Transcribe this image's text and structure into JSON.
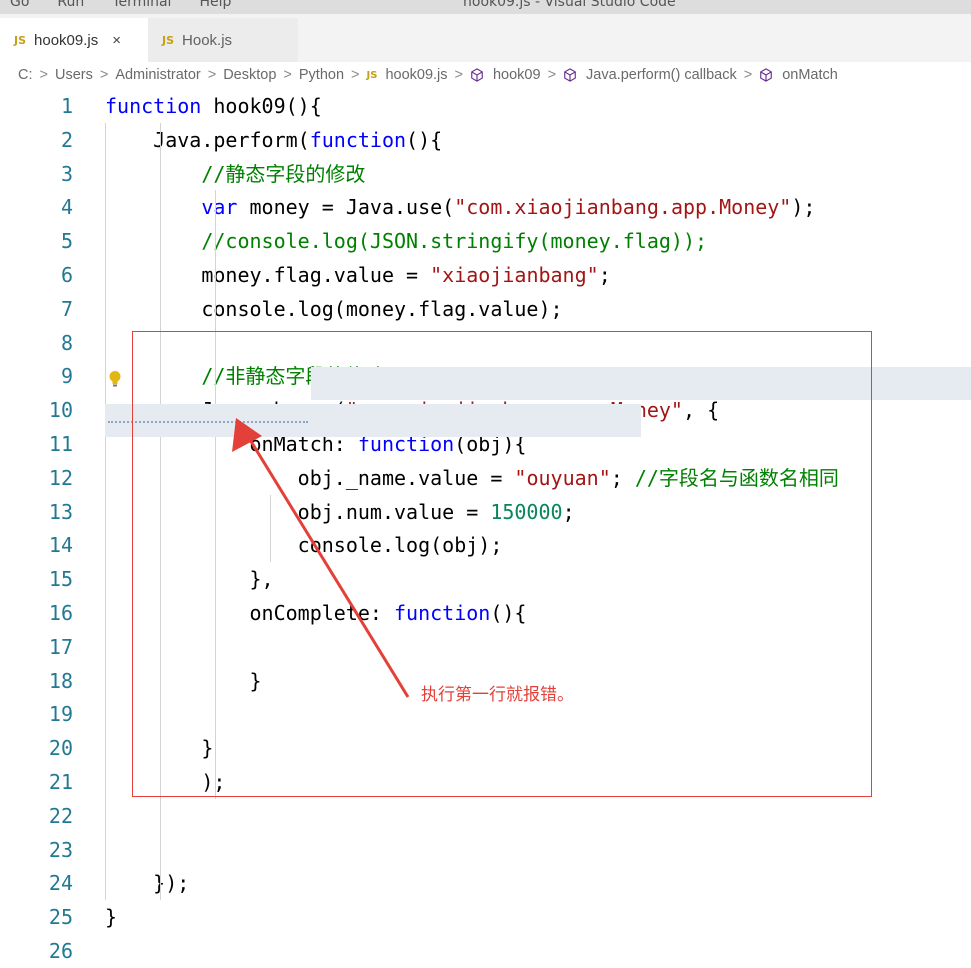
{
  "titlebar": {
    "menu": [
      "Go",
      "Run",
      "Terminal",
      "Help"
    ],
    "title": "hook09.js - Visual Studio Code"
  },
  "tabs": [
    {
      "icon": "JS",
      "label": "hook09.js",
      "active": true,
      "close": "×"
    },
    {
      "icon": "JS",
      "label": "Hook.js",
      "active": false
    }
  ],
  "breadcrumb": {
    "items": [
      "C:",
      "Users",
      "Administrator",
      "Desktop",
      "Python",
      "hook09.js",
      "hook09",
      "Java.perform() callback",
      "onMatch"
    ],
    "separator": ">"
  },
  "annotation": {
    "text": "执行第一行就报错。",
    "color": "#e4403a"
  },
  "colors": {
    "keyword": "#0000ff",
    "string": "#a31515",
    "comment": "#008000",
    "number": "#098658",
    "lineNumber": "#237893",
    "annotation": "#e4403a"
  },
  "code": {
    "lines": [
      {
        "n": "1",
        "tokens": [
          {
            "c": "kw",
            "t": "function"
          },
          {
            "c": "",
            "t": " hook09(){"
          }
        ]
      },
      {
        "n": "2",
        "tokens": [
          {
            "c": "",
            "t": "    Java.perform("
          },
          {
            "c": "kw",
            "t": "function"
          },
          {
            "c": "",
            "t": "(){"
          }
        ]
      },
      {
        "n": "3",
        "tokens": [
          {
            "c": "cm",
            "t": "        //静态字段的修改"
          }
        ]
      },
      {
        "n": "4",
        "tokens": [
          {
            "c": "",
            "t": "        "
          },
          {
            "c": "kw",
            "t": "var"
          },
          {
            "c": "",
            "t": " money = Java.use("
          },
          {
            "c": "str",
            "t": "\"com.xiaojianbang.app.Money\""
          },
          {
            "c": "",
            "t": ");"
          }
        ]
      },
      {
        "n": "5",
        "tokens": [
          {
            "c": "cm",
            "t": "        //console.log(JSON.stringify(money.flag));"
          }
        ]
      },
      {
        "n": "6",
        "tokens": [
          {
            "c": "",
            "t": "        money.flag.value = "
          },
          {
            "c": "str",
            "t": "\"xiaojianbang\""
          },
          {
            "c": "",
            "t": ";"
          }
        ]
      },
      {
        "n": "7",
        "tokens": [
          {
            "c": "",
            "t": "        console.log(money.flag.value);"
          }
        ]
      },
      {
        "n": "8",
        "tokens": []
      },
      {
        "n": "9",
        "tokens": [
          {
            "c": "cm",
            "t": "        //非静态字段的修改"
          }
        ]
      },
      {
        "n": "10",
        "tokens": [
          {
            "c": "",
            "t": "        Java.choose("
          },
          {
            "c": "str",
            "t": "\"com.xiaojianbang.app.Money\""
          },
          {
            "c": "",
            "t": ", {"
          }
        ]
      },
      {
        "n": "11",
        "tokens": [
          {
            "c": "",
            "t": "            onMatch: "
          },
          {
            "c": "kw",
            "t": "function"
          },
          {
            "c": "",
            "t": "(obj){"
          }
        ]
      },
      {
        "n": "12",
        "tokens": [
          {
            "c": "",
            "t": "                obj._name.value = "
          },
          {
            "c": "str",
            "t": "\"ouyuan\""
          },
          {
            "c": "",
            "t": "; "
          },
          {
            "c": "cm",
            "t": "//字段名与函数名相同"
          }
        ]
      },
      {
        "n": "13",
        "tokens": [
          {
            "c": "",
            "t": "                obj.num.value = "
          },
          {
            "c": "num",
            "t": "150000"
          },
          {
            "c": "",
            "t": ";"
          }
        ]
      },
      {
        "n": "14",
        "tokens": [
          {
            "c": "",
            "t": "                console.log(obj);"
          }
        ]
      },
      {
        "n": "15",
        "tokens": [
          {
            "c": "",
            "t": "            },"
          }
        ]
      },
      {
        "n": "16",
        "tokens": [
          {
            "c": "",
            "t": "            onComplete: "
          },
          {
            "c": "kw",
            "t": "function"
          },
          {
            "c": "",
            "t": "(){"
          }
        ]
      },
      {
        "n": "17",
        "tokens": []
      },
      {
        "n": "18",
        "tokens": [
          {
            "c": "",
            "t": "            }"
          }
        ]
      },
      {
        "n": "19",
        "tokens": []
      },
      {
        "n": "20",
        "tokens": [
          {
            "c": "",
            "t": "        }"
          }
        ]
      },
      {
        "n": "21",
        "tokens": [
          {
            "c": "",
            "t": "        );"
          }
        ]
      },
      {
        "n": "22",
        "tokens": []
      },
      {
        "n": "23",
        "tokens": []
      },
      {
        "n": "24",
        "tokens": [
          {
            "c": "",
            "t": "    });"
          }
        ]
      },
      {
        "n": "25",
        "tokens": [
          {
            "c": "",
            "t": "}"
          }
        ]
      },
      {
        "n": "26",
        "tokens": []
      }
    ]
  }
}
